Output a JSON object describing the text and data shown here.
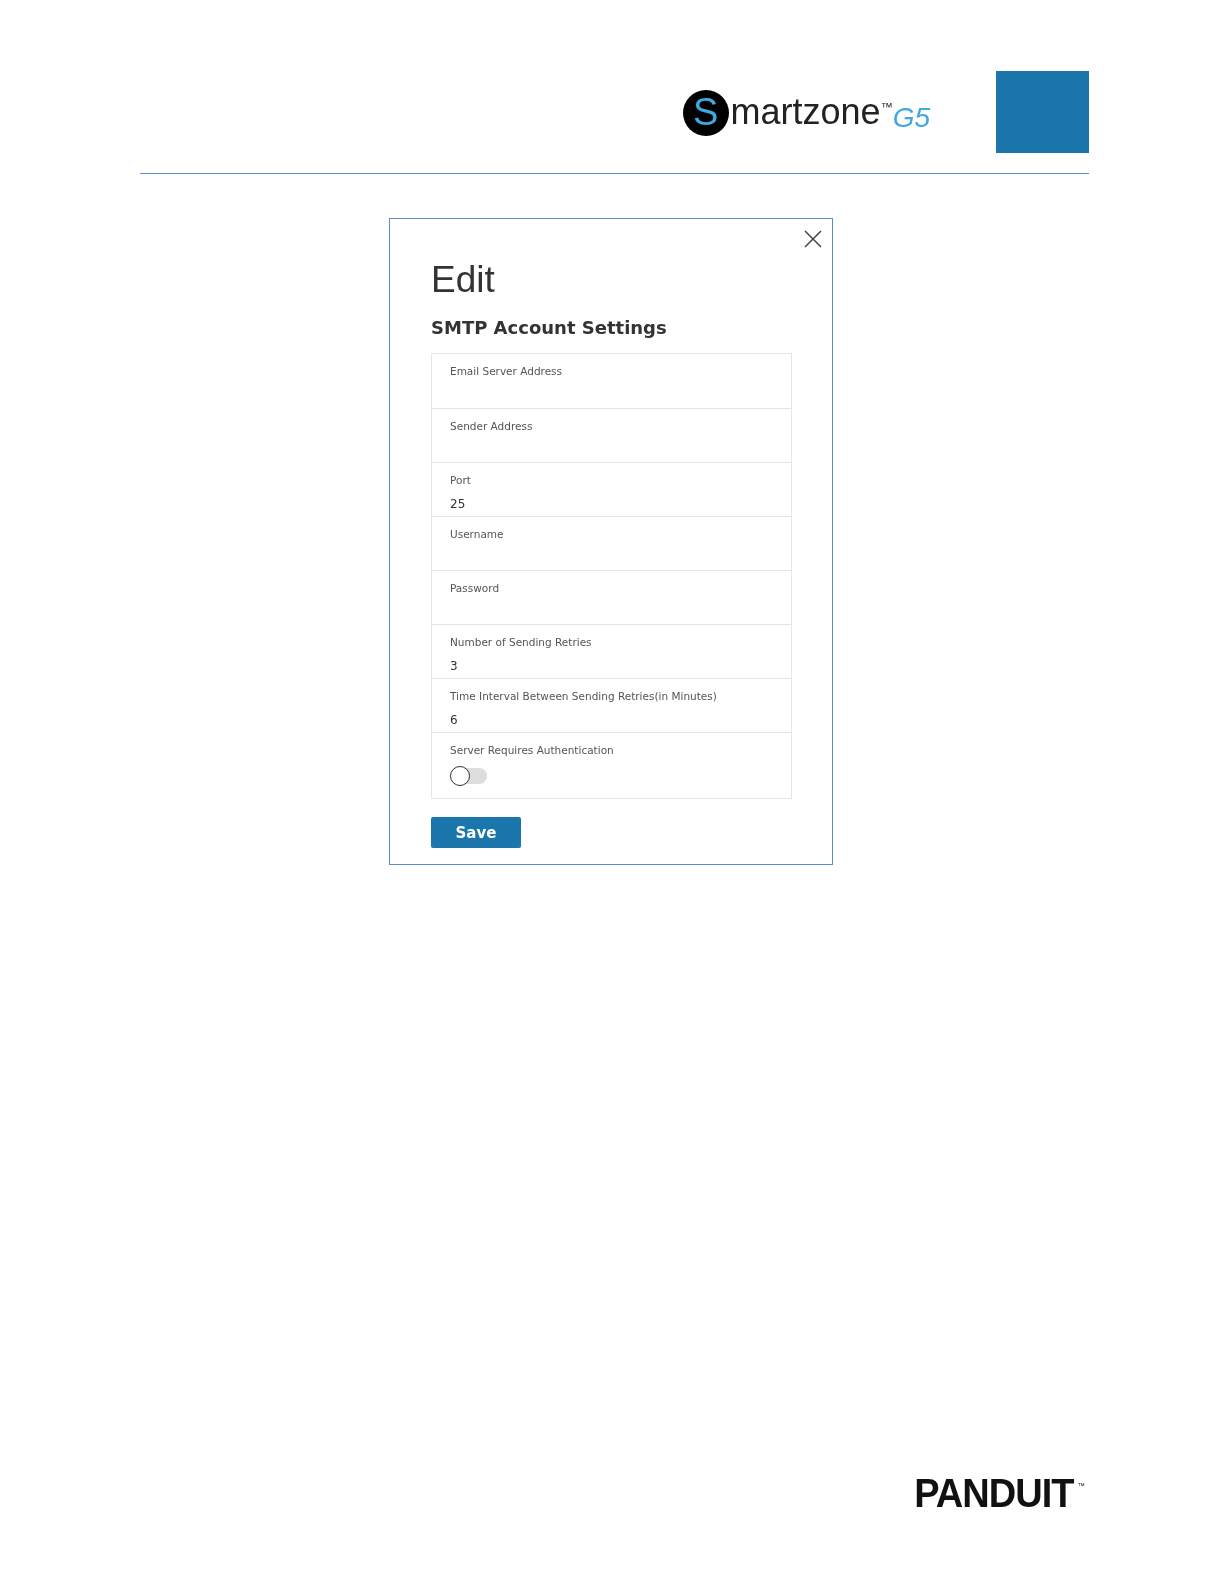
{
  "header": {
    "logo": {
      "initial": "S",
      "name": "martzone",
      "trademark": "™",
      "edition": "G5"
    }
  },
  "dialog": {
    "title": "Edit",
    "subtitle": "SMTP Account Settings",
    "fields": [
      {
        "kind": "text",
        "label": "Email Server Address"
      },
      {
        "kind": "text",
        "label": "Sender Address"
      },
      {
        "kind": "text",
        "label": "Port",
        "value": "25"
      },
      {
        "kind": "text",
        "label": "Username"
      },
      {
        "kind": "text",
        "label": "Password"
      },
      {
        "kind": "text",
        "label": "Number of Sending Retries",
        "value": "3"
      },
      {
        "kind": "text",
        "label": "Time Interval Between Sending Retries(in Minutes)",
        "value": "6"
      },
      {
        "kind": "toggle",
        "label": "Server Requires Authentication",
        "on": false
      }
    ],
    "buttons": [
      "Save"
    ]
  },
  "footer": {
    "logo": {
      "name": "PANDUIT",
      "trademark": "™"
    }
  }
}
